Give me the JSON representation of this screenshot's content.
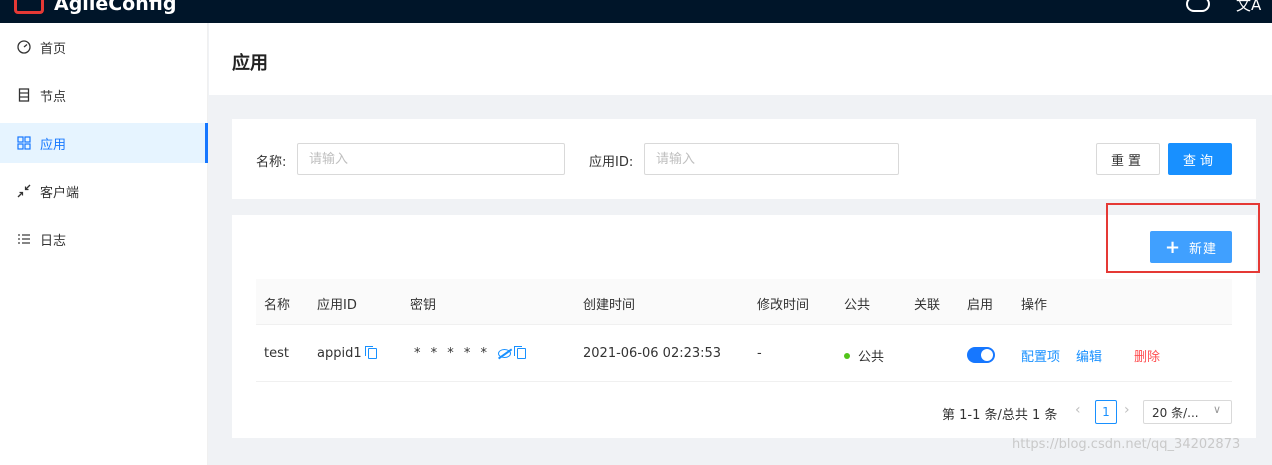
{
  "app": {
    "name": "AgileConfig"
  },
  "sidebar": {
    "items": [
      {
        "label": "首页",
        "icon": "dashboard-icon"
      },
      {
        "label": "节点",
        "icon": "server-icon"
      },
      {
        "label": "应用",
        "icon": "appstore-icon",
        "active": true
      },
      {
        "label": "客户端",
        "icon": "shrink-icon"
      },
      {
        "label": "日志",
        "icon": "list-icon"
      }
    ]
  },
  "page": {
    "title": "应用"
  },
  "search": {
    "name_label": "名称:",
    "name_placeholder": "请输入",
    "appid_label": "应用ID:",
    "appid_placeholder": "请输入",
    "reset_label": "重置",
    "query_label": "查询"
  },
  "toolbar": {
    "new_label": "新建"
  },
  "table": {
    "columns": [
      "名称",
      "应用ID",
      "密钥",
      "创建时间",
      "修改时间",
      "公共",
      "关联",
      "启用",
      "操作"
    ],
    "rows": [
      {
        "name": "test",
        "app_id": "appid1",
        "secret": "* * * * *",
        "created": "2021-06-06 02:23:53",
        "modified": "-",
        "public": "公共",
        "related": "",
        "enabled": true,
        "actions": {
          "config": "配置项",
          "edit": "编辑",
          "delete": "删除"
        }
      }
    ]
  },
  "pagination": {
    "total_text": "第 1-1 条/总共 1 条",
    "current_page": "1",
    "page_size": "20 条/..."
  },
  "watermark": "https://blog.csdn.net/qq_34202873",
  "colors": {
    "accent": "#1890ff",
    "danger": "#ff4d4f",
    "success": "#52c41a",
    "topbar": "#001529"
  }
}
